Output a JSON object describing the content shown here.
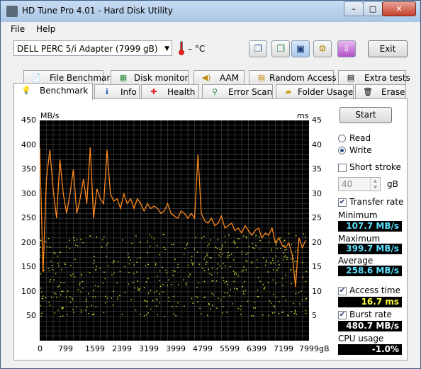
{
  "window": {
    "title": "HD Tune Pro 4.01 - Hard Disk Utility",
    "controls": {
      "min": "–",
      "max": "□",
      "close": "✕"
    }
  },
  "menu": [
    "File",
    "Help"
  ],
  "toolbar": {
    "drive": "DELL    PERC 5/i Adapter (7999 gB)",
    "temperature": "– °C",
    "exit_label": "Exit",
    "icons": [
      "copy-text-icon",
      "copy-screenshot-icon",
      "save-icon",
      "options-icon",
      "download-icon"
    ]
  },
  "tabs_top": [
    {
      "label": "File Benchmark",
      "icon": "file-benchmark-icon"
    },
    {
      "label": "Disk monitor",
      "icon": "disk-monitor-icon"
    },
    {
      "label": "AAM",
      "icon": "speaker-icon"
    },
    {
      "label": "Random Access",
      "icon": "random-access-icon"
    },
    {
      "label": "Extra tests",
      "icon": "extra-tests-icon"
    }
  ],
  "tabs_bottom": [
    {
      "label": "Benchmark",
      "icon": "benchmark-icon",
      "active": true
    },
    {
      "label": "Info",
      "icon": "info-icon"
    },
    {
      "label": "Health",
      "icon": "health-icon"
    },
    {
      "label": "Error Scan",
      "icon": "magnifier-icon"
    },
    {
      "label": "Folder Usage",
      "icon": "folder-icon"
    },
    {
      "label": "Erase",
      "icon": "trash-icon"
    }
  ],
  "controls": {
    "start_label": "Start",
    "read_label": "Read",
    "write_label": "Write",
    "mode": "write",
    "short_stroke_label": "Short stroke",
    "short_stroke_checked": false,
    "short_stroke_value": "40",
    "short_stroke_unit": "gB",
    "transfer_rate_label": "Transfer rate",
    "transfer_rate_checked": true,
    "minimum_label": "Minimum",
    "minimum_value": "107.7 MB/s",
    "maximum_label": "Maximum",
    "maximum_value": "399.7 MB/s",
    "average_label": "Average",
    "average_value": "258.6 MB/s",
    "access_time_label": "Access time",
    "access_time_checked": true,
    "access_time_value": "16.7 ms",
    "burst_rate_label": "Burst rate",
    "burst_rate_checked": true,
    "burst_rate_value": "480.7 MB/s",
    "cpu_usage_label": "CPU usage",
    "cpu_usage_value": "-1.0%"
  },
  "chart_data": {
    "type": "line",
    "y_left_label": "MB/s",
    "y_right_label": "ms",
    "y_left_ticks": [
      "450",
      "400",
      "350",
      "300",
      "250",
      "200",
      "150",
      "100",
      "50"
    ],
    "y_right_ticks": [
      "45",
      "40",
      "35",
      "30",
      "25",
      "20",
      "15",
      "10",
      "5"
    ],
    "x_ticks": [
      "0",
      "799",
      "1599",
      "2399",
      "3199",
      "3999",
      "4799",
      "5599",
      "6399",
      "7199",
      "7999gB"
    ],
    "ylim_left": [
      0,
      450
    ],
    "ylim_right": [
      0,
      45
    ],
    "xlim": [
      0,
      7999
    ],
    "grid": true,
    "colors": {
      "transfer": "#ff8a1c",
      "access": "#e8e830",
      "grid": "#4a4a4a",
      "background": "#000000"
    },
    "series": [
      {
        "name": "Transfer rate",
        "unit": "MB/s",
        "x": [
          0,
          100,
          200,
          300,
          400,
          500,
          600,
          700,
          800,
          900,
          1000,
          1100,
          1200,
          1300,
          1400,
          1500,
          1600,
          1700,
          1800,
          1900,
          2000,
          2100,
          2200,
          2300,
          2400,
          2500,
          2600,
          2700,
          2800,
          2900,
          3000,
          3100,
          3200,
          3300,
          3400,
          3500,
          3600,
          3700,
          3800,
          3900,
          4000,
          4100,
          4200,
          4300,
          4400,
          4500,
          4600,
          4700,
          4800,
          4900,
          5000,
          5100,
          5200,
          5300,
          5400,
          5500,
          5600,
          5700,
          5800,
          5900,
          6000,
          6100,
          6200,
          6300,
          6400,
          6500,
          6600,
          6700,
          6800,
          6900,
          7000,
          7100,
          7200,
          7300,
          7400,
          7500,
          7600,
          7700,
          7800,
          7900
        ],
        "y": [
          395,
          140,
          330,
          390,
          310,
          250,
          370,
          300,
          260,
          300,
          350,
          260,
          290,
          330,
          280,
          395,
          250,
          310,
          290,
          280,
          390,
          300,
          285,
          290,
          270,
          300,
          280,
          290,
          270,
          290,
          280,
          265,
          280,
          270,
          275,
          270,
          260,
          265,
          280,
          260,
          255,
          250,
          265,
          260,
          250,
          260,
          250,
          380,
          260,
          245,
          240,
          250,
          235,
          240,
          255,
          230,
          235,
          240,
          225,
          230,
          220,
          235,
          225,
          215,
          225,
          230,
          210,
          220,
          215,
          230,
          200,
          210,
          195,
          190,
          200,
          175,
          110,
          210,
          190,
          205
        ]
      },
      {
        "name": "Access time",
        "unit": "ms",
        "style": "scatter",
        "range_ms": [
          5,
          22
        ]
      }
    ]
  }
}
